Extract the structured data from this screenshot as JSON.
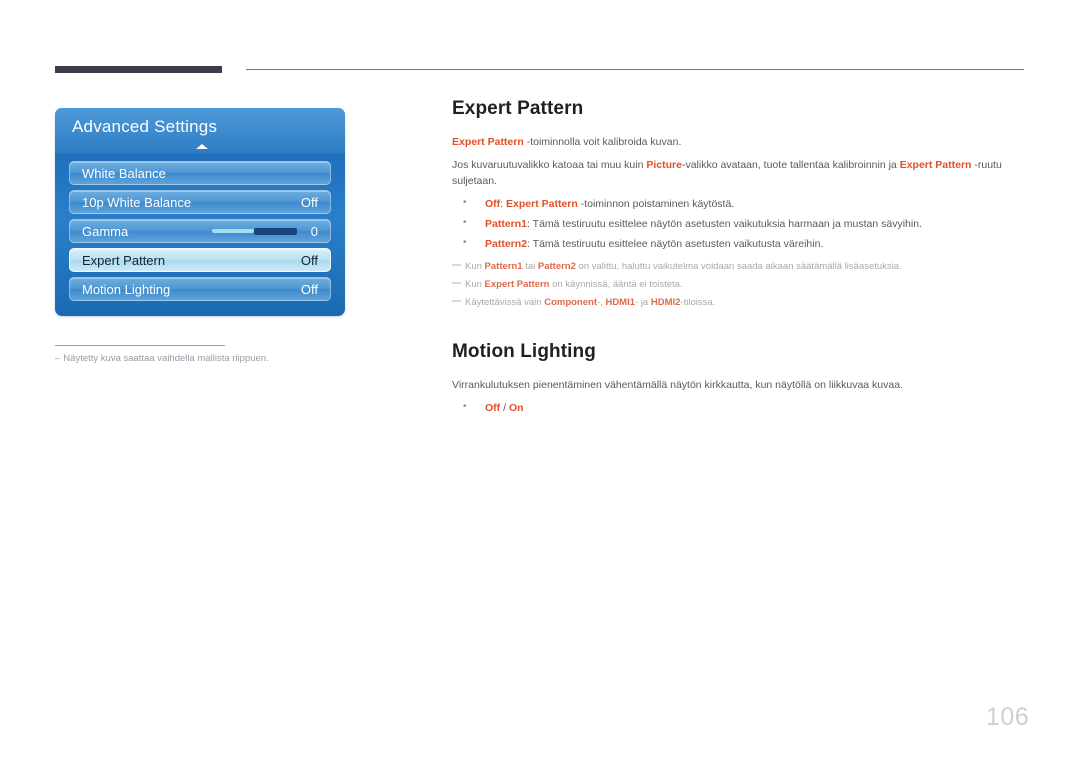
{
  "page": {
    "number": "106"
  },
  "osd": {
    "title": "Advanced Settings",
    "up_arrow_icon": "caret-up-icon",
    "rows": [
      {
        "label": "White Balance",
        "value": ""
      },
      {
        "label": "10p White Balance",
        "value": "Off"
      },
      {
        "label": "Gamma",
        "value": "0"
      },
      {
        "label": "Expert Pattern",
        "value": "Off"
      },
      {
        "label": "Motion Lighting",
        "value": "Off"
      }
    ],
    "highlight_index": 3,
    "slider": {
      "value": "0",
      "fill_percent": 50
    },
    "colors": {
      "panel_top": "#4f9ad8",
      "panel_bottom": "#1b6ab4",
      "row": "#4e97d4",
      "row_highlight": "#b9e2f4",
      "slider_left": "#9fe0e8",
      "slider_right": "#16457e"
    }
  },
  "caption": {
    "dash": "–",
    "text": "Näytetty kuva saattaa vaihdella mallista riippuen."
  },
  "content": {
    "expert_pattern": {
      "heading": "Expert Pattern",
      "intro_1": {
        "kw": "Expert Pattern",
        "rest": " -toiminnolla voit kalibroida kuvan."
      },
      "intro_2": {
        "part1": "Jos kuvaruutuvalikko katoaa tai muu kuin ",
        "kw1": "Picture",
        "part2": "-valikko avataan, tuote tallentaa kalibroinnin ja ",
        "kw2": "Expert Pattern",
        "part3": " -ruutu suljetaan."
      },
      "bullets": [
        {
          "kw1": "Off",
          "sep": ": ",
          "kw2": "Expert Pattern",
          "rest": " -toiminnon poistaminen käytöstä."
        },
        {
          "kw1": "Pattern1",
          "sep": ": ",
          "kw2": "",
          "rest": "Tämä testiruutu esittelee näytön asetusten vaikutuksia harmaan ja mustan sävyihin."
        },
        {
          "kw1": "Pattern2",
          "sep": ": ",
          "kw2": "",
          "rest": "Tämä testiruutu esittelee näytön asetusten vaikutusta väreihin."
        }
      ],
      "notes": [
        {
          "p1": "Kun ",
          "k1": "Pattern1",
          "p2": " tai ",
          "k2": "Pattern2",
          "p3": " on valittu, haluttu vaikutelma voidaan saada aikaan säätämällä lisäasetuksia.",
          "k3": "",
          "p4": ""
        },
        {
          "p1": "Kun ",
          "k1": "Expert Pattern",
          "p2": " on käynnissä, ääntä ei toisteta.",
          "k2": "",
          "p3": "",
          "k3": "",
          "p4": ""
        },
        {
          "p1": "Käytettävissä vain ",
          "k1": "Component",
          "p2": "-, ",
          "k2": "HDMI1",
          "p3": "- ja ",
          "k3": "HDMI2",
          "p4": "-tiloissa."
        }
      ]
    },
    "motion_lighting": {
      "heading": "Motion Lighting",
      "description": "Virrankulutuksen pienentäminen vähentämällä näytön kirkkautta, kun näytöllä on liikkuvaa kuvaa.",
      "bullet": {
        "kw1": "Off",
        "sep": " / ",
        "kw2": "On"
      }
    }
  }
}
